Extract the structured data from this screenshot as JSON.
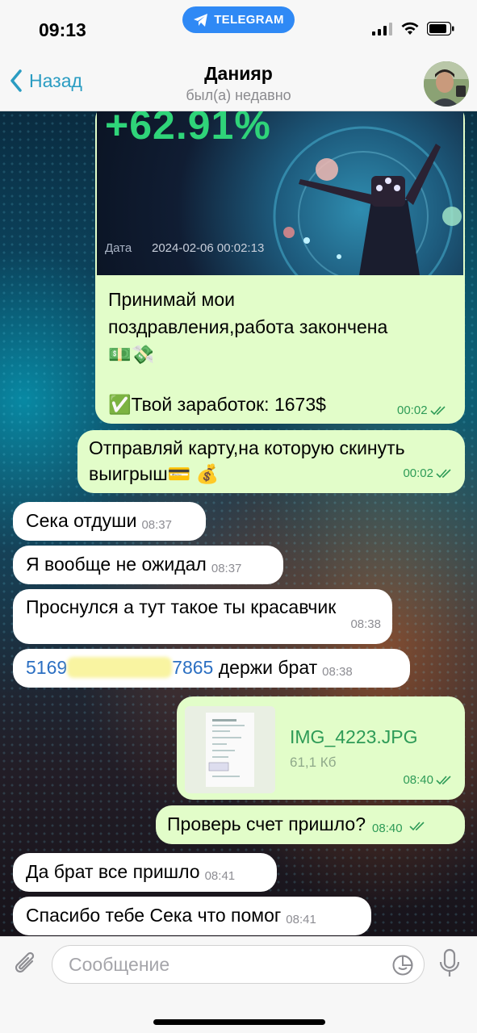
{
  "status_bar": {
    "time": "09:13",
    "pill_label": "TELEGRAM"
  },
  "nav": {
    "back_label": "Назад",
    "contact_name": "Данияр",
    "contact_status": "был(а) недавно"
  },
  "messages": {
    "card": {
      "percent": "+62.91%",
      "date_label": "Дата",
      "date_value": "2024-02-06 00:02:13",
      "text_line1": "Принимай мои",
      "text_line2": "поздравления,работа закончена",
      "text_emoji": "💵💸",
      "earnings": "✅Твой заработок: 1673$",
      "time": "00:02"
    },
    "m2": {
      "line1": "Отправляй карту,на которую скинуть",
      "line2": "выигрыш💳 💰",
      "time": "00:02"
    },
    "m3": {
      "text": "Сека отдуши",
      "time": "08:37"
    },
    "m4": {
      "text": "Я вообще не ожидал",
      "time": "08:37"
    },
    "m5": {
      "text": "Проснулся а тут такое ты красавчик",
      "time": "08:38"
    },
    "m6": {
      "card_start": "5169",
      "card_end": "7865",
      "text": " держи брат",
      "time": "08:38"
    },
    "file": {
      "name": "IMG_4223.JPG",
      "size": "61,1 Кб",
      "time": "08:40"
    },
    "m8": {
      "text": "Проверь счет пришло?",
      "time": "08:40"
    },
    "m9": {
      "text": "Да брат все пришло",
      "time": "08:41"
    },
    "m10": {
      "text": "Спасибо тебе Сека что помог",
      "time": "08:41"
    }
  },
  "composer": {
    "placeholder": "Сообщение"
  },
  "colors": {
    "outgoing_bubble": "#e2fdc9",
    "incoming_bubble": "#ffffff",
    "accent": "#2a9cc2",
    "telegram_pill": "#2f89f5"
  }
}
